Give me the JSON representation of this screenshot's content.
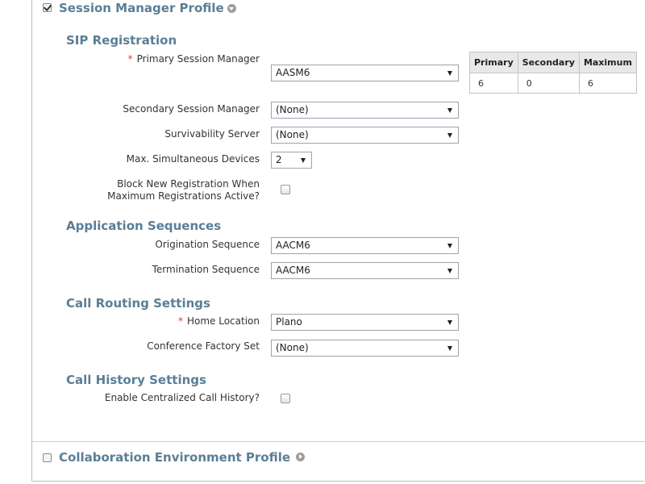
{
  "session_manager_profile": {
    "title": "Session Manager Profile",
    "checked": true
  },
  "sip_registration": {
    "heading": "SIP Registration",
    "primary_label": "Primary Session Manager",
    "primary_value": "AASM6",
    "secondary_label": "Secondary Session Manager",
    "secondary_value": "(None)",
    "survivability_label": "Survivability Server",
    "survivability_value": "(None)",
    "max_devices_label": "Max. Simultaneous Devices",
    "max_devices_value": "2",
    "block_label_line1": "Block New Registration When",
    "block_label_line2": "Maximum Registrations Active?",
    "block_checked": false
  },
  "registration_table": {
    "headers": [
      "Primary",
      "Secondary",
      "Maximum"
    ],
    "values": [
      "6",
      "0",
      "6"
    ]
  },
  "application_sequences": {
    "heading": "Application Sequences",
    "origination_label": "Origination Sequence",
    "origination_value": "AACM6",
    "termination_label": "Termination Sequence",
    "termination_value": "AACM6"
  },
  "call_routing": {
    "heading": "Call Routing Settings",
    "home_location_label": "Home Location",
    "home_location_value": "Plano",
    "conference_label": "Conference Factory Set",
    "conference_value": "(None)"
  },
  "call_history": {
    "heading": "Call History Settings",
    "enable_label": "Enable Centralized Call History?",
    "enable_checked": false
  },
  "collaboration_profile": {
    "title": "Collaboration Environment Profile",
    "checked": false
  },
  "required_marker": "*"
}
